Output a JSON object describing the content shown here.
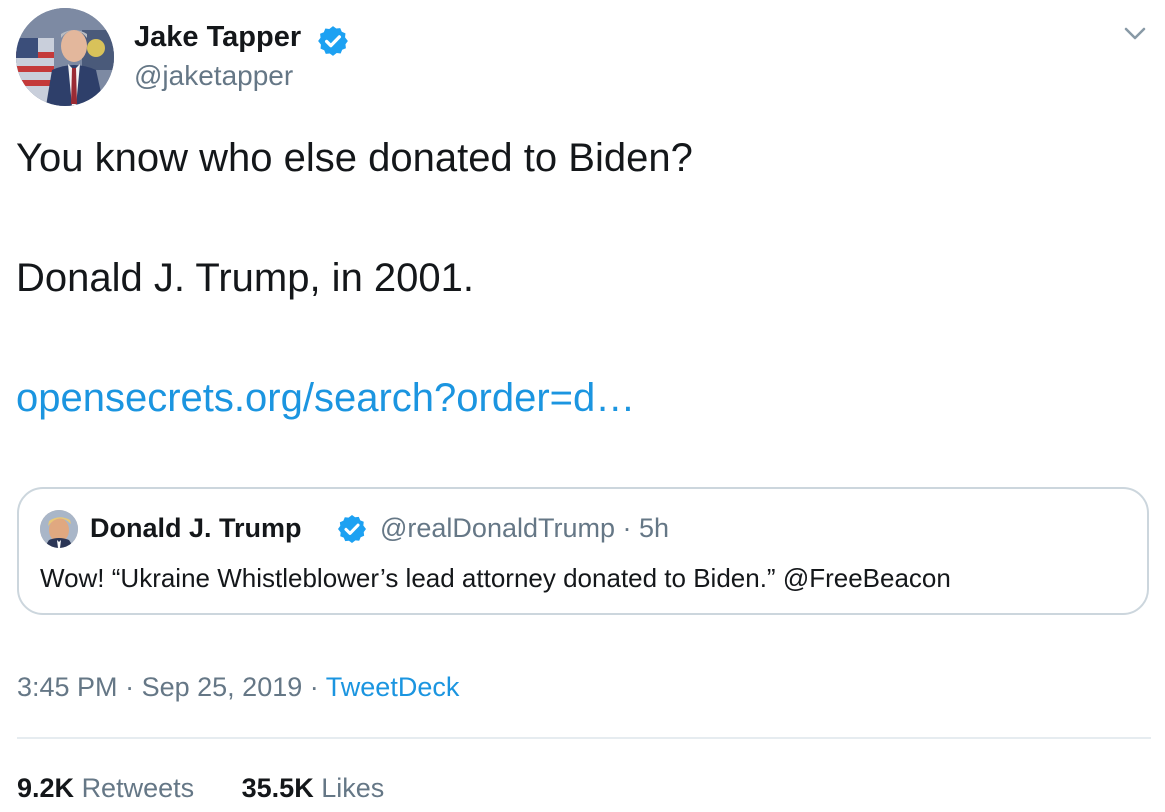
{
  "author": {
    "name": "Jake Tapper",
    "handle": "@jaketapper",
    "verified": true
  },
  "tweet": {
    "line1": "You know who else donated to Biden?",
    "line2": "Donald J. Trump, in 2001.",
    "link": "opensecrets.org/search?order=d…"
  },
  "quoted": {
    "name": "Donald J. Trump",
    "handle": "@realDonaldTrump",
    "separator": "·",
    "age": "5h",
    "text": "Wow! “Ukraine Whistleblower’s lead attorney donated to Biden.” @FreeBeacon"
  },
  "footer": {
    "time": "3:45 PM",
    "separator": "·",
    "date": "Sep 25, 2019",
    "source": "TweetDeck"
  },
  "stats": {
    "retweets_count": "9.2K",
    "retweets_label": "Retweets",
    "likes_count": "35.5K",
    "likes_label": "Likes"
  },
  "colors": {
    "link": "#1b95e0",
    "verified": "#1da1f2",
    "secondary_text": "#657786",
    "border": "#ccd6dd"
  },
  "icons": {
    "verified": "verified-badge-icon",
    "menu": "chevron-down-icon"
  }
}
